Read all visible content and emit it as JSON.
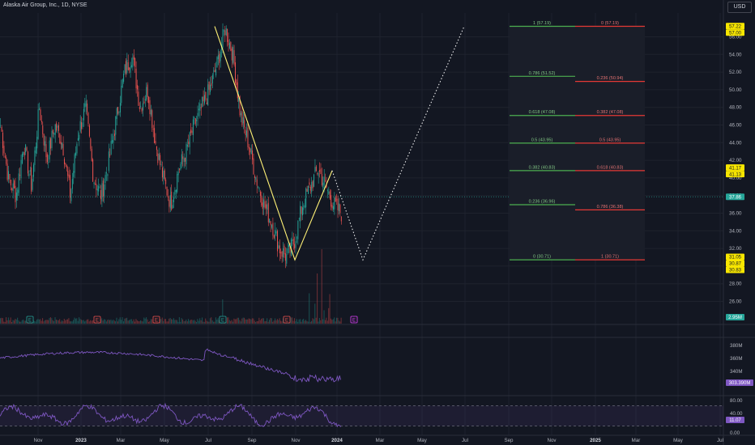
{
  "header": {
    "title": "Alaska Air Group, Inc., 1D, NYSE",
    "currency": "USD"
  },
  "chart_data": {
    "type": "candlestick",
    "x_ticks": [
      "Nov",
      "2023",
      "Mar",
      "May",
      "Jul",
      "Sep",
      "Nov",
      "2024",
      "Mar",
      "May",
      "Jul",
      "Sep",
      "Nov",
      "2025",
      "Mar",
      "May",
      "Jul"
    ],
    "price_axis": {
      "ticks": [
        "56.00",
        "54.00",
        "52.00",
        "50.00",
        "48.00",
        "46.00",
        "44.00",
        "42.00",
        "40.00",
        "38.00",
        "36.00",
        "34.00",
        "32.00",
        "30.00",
        "28.00",
        "26.00"
      ],
      "min": 24.9,
      "max": 60.1
    },
    "price_labels": [
      {
        "text": "57.22",
        "value": 57.22,
        "color": "#f7e600",
        "text_color": "#131722"
      },
      {
        "text": "57.00",
        "value": 57.0,
        "color": "#f7e600",
        "text_color": "#131722"
      },
      {
        "text": "41.17",
        "value": 41.17,
        "color": "#f7e600",
        "text_color": "#131722"
      },
      {
        "text": "41.13",
        "value": 41.13,
        "color": "#f7e600",
        "text_color": "#131722"
      },
      {
        "text": "37.86",
        "value": 37.86,
        "color": "#26a69a",
        "text_color": "#ffffff"
      },
      {
        "text": "31.05",
        "value": 31.05,
        "color": "#f7e600",
        "text_color": "#131722"
      },
      {
        "text": "30.87",
        "value": 30.87,
        "color": "#f7e600",
        "text_color": "#131722"
      },
      {
        "text": "30.87",
        "value": 30.87,
        "color": "#f7e600",
        "text_color": "#131722"
      },
      {
        "text": "30.83",
        "value": 30.83,
        "color": "#f7e600",
        "text_color": "#131722"
      }
    ],
    "current_price": 37.86,
    "volume_label": "2.95M",
    "fib_left": [
      {
        "label": "1 (57.19)",
        "value": 57.19
      },
      {
        "label": "0.786 (51.52)",
        "value": 51.52
      },
      {
        "label": "0.618 (47.08)",
        "value": 47.08
      },
      {
        "label": "0.5 (43.95)",
        "value": 43.95
      },
      {
        "label": "0.382 (40.83)",
        "value": 40.83
      },
      {
        "label": "0.236 (36.96)",
        "value": 36.96
      },
      {
        "label": "0 (30.71)",
        "value": 30.71
      }
    ],
    "fib_right": [
      {
        "label": "0 (57.19)",
        "value": 57.19
      },
      {
        "label": "0.236 (50.94)",
        "value": 50.94
      },
      {
        "label": "0.382 (47.08)",
        "value": 47.08
      },
      {
        "label": "0.5 (43.95)",
        "value": 43.95
      },
      {
        "label": "0.618 (40.83)",
        "value": 40.83
      },
      {
        "label": "0.786 (36.38)",
        "value": 36.38
      },
      {
        "label": "1 (30.71)",
        "value": 30.71
      }
    ],
    "earnings_markers": [
      {
        "label": "E",
        "color": "#26a69a"
      },
      {
        "label": "E",
        "color": "#ef5350"
      },
      {
        "label": "E",
        "color": "#ef5350"
      },
      {
        "label": "E",
        "color": "#26a69a"
      },
      {
        "label": "E",
        "color": "#ef5350"
      },
      {
        "label": "E",
        "color": "#e040fb"
      }
    ],
    "indicator1": {
      "ticks": [
        "380M",
        "360M",
        "340M"
      ],
      "min": 300,
      "max": 400,
      "label": "303.390M"
    },
    "indicator2": {
      "ticks": [
        "80.00",
        "40.00",
        "0.00"
      ],
      "min": 0,
      "max": 100,
      "upper_band": 80,
      "lower_band": 20,
      "label": "11.07"
    },
    "anchor_prices": [
      46,
      40,
      38,
      44,
      39,
      48,
      42,
      46,
      44,
      38,
      45,
      48,
      40,
      38,
      42,
      47,
      52,
      54,
      48,
      50,
      44,
      40,
      37,
      41,
      43,
      46,
      48,
      50,
      53,
      57,
      54,
      47,
      44,
      40,
      37,
      35,
      32,
      31,
      33,
      37,
      39,
      41,
      39,
      37,
      36
    ],
    "zigzag": [
      57.19,
      30.71,
      40.83
    ],
    "projection": [
      40.83,
      30.71,
      57.19
    ]
  }
}
